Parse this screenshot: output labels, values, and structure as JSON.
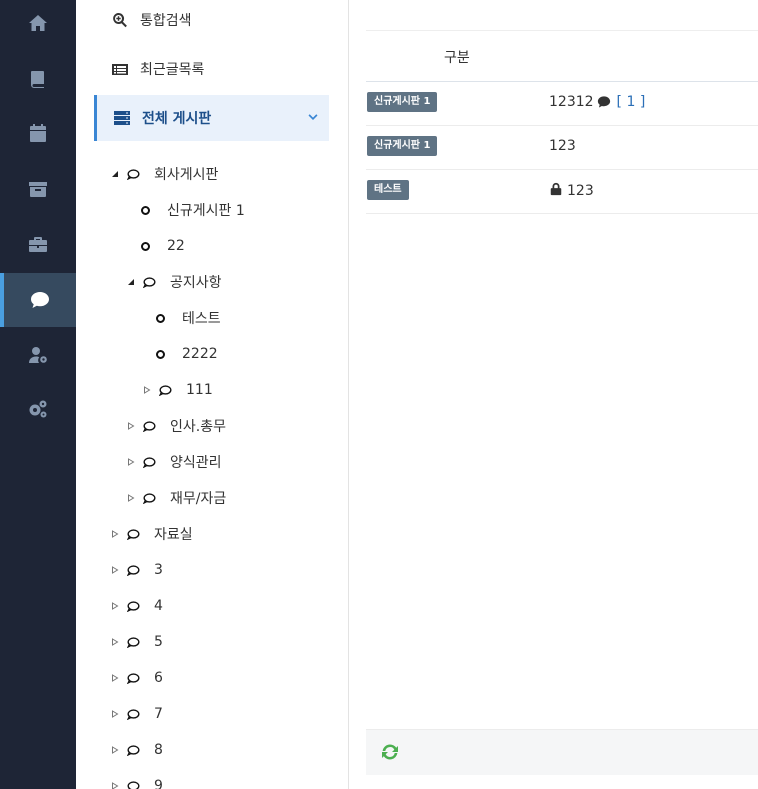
{
  "rail": {
    "items": [
      {
        "icon": "home-icon"
      },
      {
        "icon": "book-icon"
      },
      {
        "icon": "calendar-icon"
      },
      {
        "icon": "archive-icon"
      },
      {
        "icon": "briefcase-icon"
      },
      {
        "icon": "comment-icon",
        "active": true
      },
      {
        "icon": "user-gear-icon"
      },
      {
        "icon": "gears-icon"
      }
    ]
  },
  "menu": {
    "search_label": "통합검색",
    "recent_label": "최근글목록",
    "all_boards_label": "전체 게시판",
    "tree": {
      "company_board": "회사게시판",
      "new_board": "신규게시판 1",
      "n22": "22",
      "notice": "공지사항",
      "test": "테스트",
      "n2222": "2222",
      "n111": "111",
      "hr": "인사.총무",
      "forms": "양식관리",
      "finance": "재무/자금",
      "library": "자료실",
      "n3": "3",
      "n4": "4",
      "n5": "5",
      "n6": "6",
      "n7": "7",
      "n8": "8",
      "n9": "9"
    }
  },
  "main": {
    "column_header": "구분",
    "rows": [
      {
        "badge": "신규게시판 1",
        "title": "12312",
        "has_comment": true,
        "comment_count": "[ 1 ]"
      },
      {
        "badge": "신규게시판 1",
        "title": "123"
      },
      {
        "badge": "테스트",
        "title": "123",
        "locked": true
      }
    ]
  },
  "colors": {
    "rail_bg": "#1e2536",
    "rail_active": "#364a5f",
    "accent": "#3a86d4",
    "badge": "#5f7384",
    "refresh": "#4caf50"
  }
}
